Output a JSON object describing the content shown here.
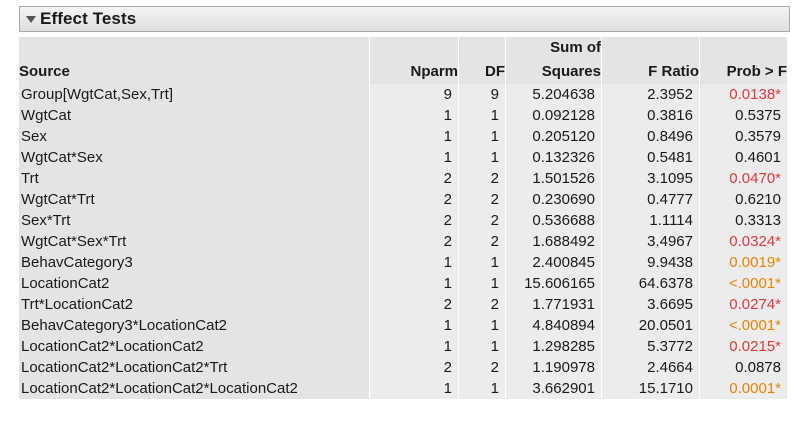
{
  "panel": {
    "title": "Effect Tests"
  },
  "columns": {
    "source": "Source",
    "nparm": "Nparm",
    "df": "DF",
    "ss_line1": "Sum of",
    "ss_line2": "Squares",
    "f_ratio": "F Ratio",
    "prob": "Prob > F"
  },
  "colors": {
    "significant_red": "#e0393e",
    "highly_significant_orange": "#e4860a"
  },
  "rows": [
    {
      "source": "Group[WgtCat,Sex,Trt]",
      "nparm": "9",
      "df": "9",
      "ss": "5.204638",
      "f": "2.3952",
      "p": "0.0138*",
      "sig": "red"
    },
    {
      "source": "WgtCat",
      "nparm": "1",
      "df": "1",
      "ss": "0.092128",
      "f": "0.3816",
      "p": "0.5375",
      "sig": "none"
    },
    {
      "source": "Sex",
      "nparm": "1",
      "df": "1",
      "ss": "0.205120",
      "f": "0.8496",
      "p": "0.3579",
      "sig": "none"
    },
    {
      "source": "WgtCat*Sex",
      "nparm": "1",
      "df": "1",
      "ss": "0.132326",
      "f": "0.5481",
      "p": "0.4601",
      "sig": "none"
    },
    {
      "source": "Trt",
      "nparm": "2",
      "df": "2",
      "ss": "1.501526",
      "f": "3.1095",
      "p": "0.0470*",
      "sig": "red"
    },
    {
      "source": "WgtCat*Trt",
      "nparm": "2",
      "df": "2",
      "ss": "0.230690",
      "f": "0.4777",
      "p": "0.6210",
      "sig": "none"
    },
    {
      "source": "Sex*Trt",
      "nparm": "2",
      "df": "2",
      "ss": "0.536688",
      "f": "1.1114",
      "p": "0.3313",
      "sig": "none"
    },
    {
      "source": "WgtCat*Sex*Trt",
      "nparm": "2",
      "df": "2",
      "ss": "1.688492",
      "f": "3.4967",
      "p": "0.0324*",
      "sig": "red"
    },
    {
      "source": "BehavCategory3",
      "nparm": "1",
      "df": "1",
      "ss": "2.400845",
      "f": "9.9438",
      "p": "0.0019*",
      "sig": "orange"
    },
    {
      "source": "LocationCat2",
      "nparm": "1",
      "df": "1",
      "ss": "15.606165",
      "f": "64.6378",
      "p": "<.0001*",
      "sig": "orange"
    },
    {
      "source": "Trt*LocationCat2",
      "nparm": "2",
      "df": "2",
      "ss": "1.771931",
      "f": "3.6695",
      "p": "0.0274*",
      "sig": "red"
    },
    {
      "source": "BehavCategory3*LocationCat2",
      "nparm": "1",
      "df": "1",
      "ss": "4.840894",
      "f": "20.0501",
      "p": "<.0001*",
      "sig": "orange"
    },
    {
      "source": "LocationCat2*LocationCat2",
      "nparm": "1",
      "df": "1",
      "ss": "1.298285",
      "f": "5.3772",
      "p": "0.0215*",
      "sig": "red"
    },
    {
      "source": "LocationCat2*LocationCat2*Trt",
      "nparm": "2",
      "df": "2",
      "ss": "1.190978",
      "f": "2.4664",
      "p": "0.0878",
      "sig": "none"
    },
    {
      "source": "LocationCat2*LocationCat2*LocationCat2",
      "nparm": "1",
      "df": "1",
      "ss": "3.662901",
      "f": "15.1710",
      "p": "0.0001*",
      "sig": "orange"
    }
  ]
}
